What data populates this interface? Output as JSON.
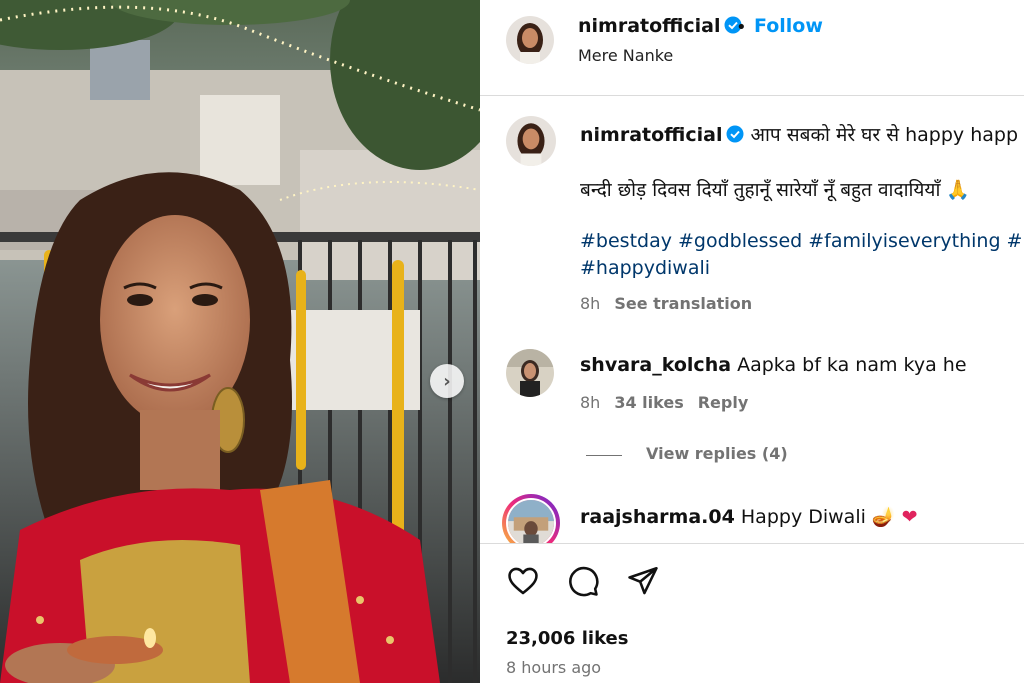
{
  "post": {
    "username": "nimratofficial",
    "follow_label": "Follow",
    "dot": "•",
    "location": "Mere Nanke"
  },
  "caption": {
    "username": "nimratofficial",
    "line1": "आप सबको मेरे घर से happy happ",
    "line2": "बन्दी छोड़ दिवस दियाँ तुहानूँ सारेयाँ नूँ बहुत वादायियाँ",
    "hashtags_line1": [
      "#bestday",
      "#godblessed",
      "#familyiseverything",
      "#love"
    ],
    "hashtags_line2": "#happydiwali",
    "age": "8h",
    "see_translation": "See translation"
  },
  "comments": [
    {
      "username": "shvara_kolcha",
      "text": "Aapka bf ka nam kya he",
      "age": "8h",
      "likes": "34 likes",
      "reply_label": "Reply",
      "view_replies": "View replies (4)"
    },
    {
      "username": "raajsharma.04",
      "text": "Happy Diwali"
    }
  ],
  "actions": {
    "likes": "23,006 likes",
    "time": "8 hours ago"
  },
  "icons": {
    "verified": "verified-badge-icon",
    "like": "heart-icon",
    "comment": "comment-bubble-icon",
    "share": "paper-plane-icon",
    "next": "chevron-right-icon"
  },
  "colors": {
    "accent": "#0095f6",
    "hashtag": "#00376b",
    "muted": "#737373",
    "saree": "#d0122a",
    "gold": "#c9a13f"
  }
}
